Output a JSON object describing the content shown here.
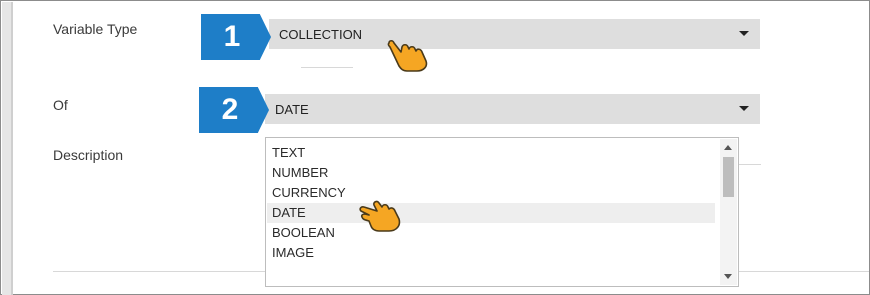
{
  "form": {
    "variable_type_label": "Variable Type",
    "of_label": "Of",
    "description_label": "Description",
    "variable_type_value": "COLLECTION",
    "of_value": "DATE"
  },
  "steps": [
    {
      "number": "1"
    },
    {
      "number": "2"
    }
  ],
  "dropdown": {
    "options": [
      "TEXT",
      "NUMBER",
      "CURRENCY",
      "DATE",
      "BOOLEAN",
      "IMAGE"
    ],
    "highlighted": "DATE"
  },
  "colors": {
    "badge": "#1e7ec8",
    "select_bg": "#dedede",
    "pointer": "#f5a623"
  },
  "icons": {
    "pointer": "hand-pointer-icon",
    "caret": "chevron-down-icon"
  }
}
